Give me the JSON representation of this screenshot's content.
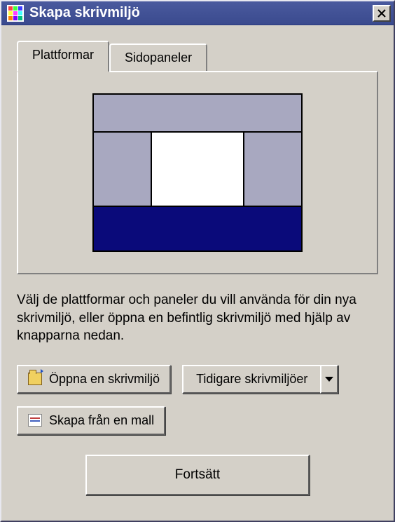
{
  "window": {
    "title": "Skapa skrivmiljö"
  },
  "tabs": {
    "platforms": "Plattformar",
    "sidepanels": "Sidopaneler"
  },
  "description": "Välj de plattformar och paneler du vill använda för din nya skrivmiljö, eller öppna en befintlig skrivmiljö med hjälp av knapparna nedan.",
  "buttons": {
    "open_env": "Öppna en skrivmiljö",
    "previous_envs": "Tidigare skrivmiljöer",
    "from_template": "Skapa från en mall",
    "continue": "Fortsätt"
  },
  "icon_colors": [
    "#ff4040",
    "#40ff40",
    "#4040ff",
    "#ffff40",
    "#ff40ff",
    "#40ffff",
    "#ff8000",
    "#8000ff",
    "#00c080"
  ]
}
